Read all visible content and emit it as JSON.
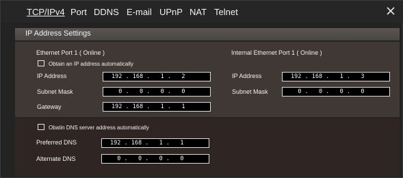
{
  "tabs": [
    {
      "label": "TCP/IPv4",
      "active": true
    },
    {
      "label": "Port"
    },
    {
      "label": "DDNS"
    },
    {
      "label": "E-mail"
    },
    {
      "label": "UPnP"
    },
    {
      "label": "NAT"
    },
    {
      "label": "Telnet"
    }
  ],
  "close_icon": "close-icon",
  "section": {
    "title": "IP Address Settings"
  },
  "eth1": {
    "heading": "Ethernet Port 1 ( Online )",
    "auto_ip_label": "Obtain an IP address automatically",
    "auto_ip_checked": false,
    "ip_label": "IP Address",
    "ip_value": "192 . 168 .   1 .   2",
    "mask_label": "Subnet Mask",
    "mask_value": "  0 .   0 .   0 .   0",
    "gateway_label": "Gateway",
    "gateway_value": "192 . 168 .   1 .   1"
  },
  "internal": {
    "heading": "Internal Ethernet Port 1 ( Online )",
    "ip_label": "IP Address",
    "ip_value": "192 . 168 .   1 .   3",
    "mask_label": "Subnet Mask",
    "mask_value": "  0 .   0 .   0 .   0"
  },
  "dns": {
    "auto_label": "Obatin DNS server address automatically",
    "auto_checked": false,
    "preferred_label": "Preferred DNS",
    "preferred_value": "192 . 168 .   1 .   1",
    "alternate_label": "Alternate DNS",
    "alternate_value": "  0 .   0 .   0 .   0"
  },
  "colors": {
    "background": "#232323",
    "panel_top": "#3f3834",
    "panel_bottom": "#2f2624",
    "input_bg": "#000000",
    "text": "#f0f0f0"
  }
}
